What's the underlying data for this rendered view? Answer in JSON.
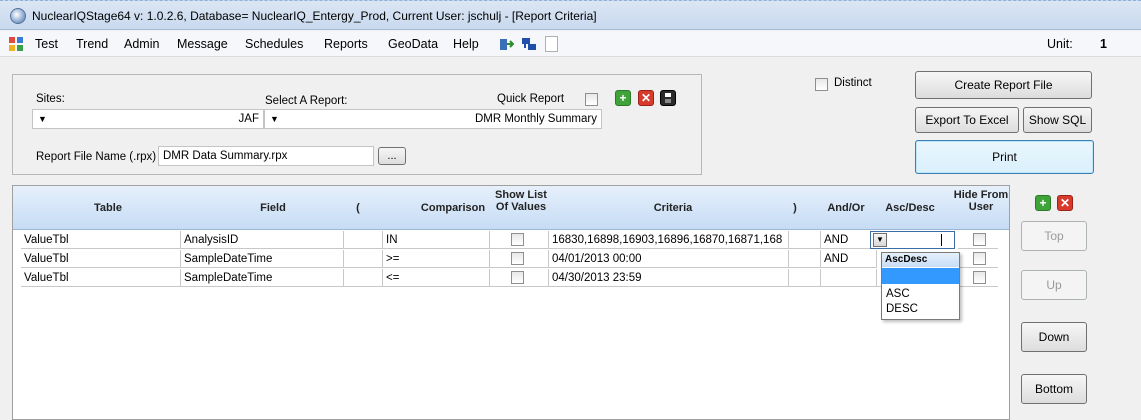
{
  "window": {
    "title": "NuclearIQStage64 v: 1.0.2.6, Database= NuclearIQ_Entergy_Prod, Current User: jschulj - [Report Criteria]"
  },
  "menu": {
    "items": [
      "Test",
      "Trend",
      "Admin",
      "Message",
      "Schedules",
      "Reports",
      "GeoData",
      "Help"
    ],
    "unit_label": "Unit:",
    "unit_value": "1"
  },
  "criteria": {
    "sites_label": "Sites:",
    "sites_value": "JAF",
    "report_label": "Select A Report:",
    "quick_report_label": "Quick Report",
    "report_value": "DMR Monthly Summary",
    "file_label": "Report File Name (.rpx)",
    "file_value": "DMR Data Summary.rpx",
    "browse_label": "...",
    "distinct_label": "Distinct"
  },
  "actions": {
    "create": "Create Report File",
    "export": "Export To Excel",
    "sql": "Show SQL",
    "print": "Print"
  },
  "grid": {
    "headers": {
      "table": "Table",
      "field": "Field",
      "open_paren": "(",
      "comparison": "Comparison",
      "show_list": "Show List Of Values",
      "criteria": "Criteria",
      "close_paren": ")",
      "and_or": "And/Or",
      "asc_desc": "Asc/Desc",
      "hide": "Hide From User"
    },
    "rows": [
      {
        "table": "ValueTbl",
        "field": "AnalysisID",
        "comparison": "IN",
        "criteria": "16830,16898,16903,16896,16870,16871,168",
        "and_or": "AND"
      },
      {
        "table": "ValueTbl",
        "field": "SampleDateTime",
        "comparison": ">=",
        "criteria": "04/01/2013 00:00",
        "and_or": "AND"
      },
      {
        "table": "ValueTbl",
        "field": "SampleDateTime",
        "comparison": "<=",
        "criteria": "04/30/2013 23:59",
        "and_or": ""
      }
    ]
  },
  "dropdown": {
    "header": "AscDesc",
    "options": [
      "",
      "ASC",
      "DESC"
    ]
  },
  "side": {
    "top": "Top",
    "up": "Up",
    "down": "Down",
    "bottom": "Bottom"
  }
}
